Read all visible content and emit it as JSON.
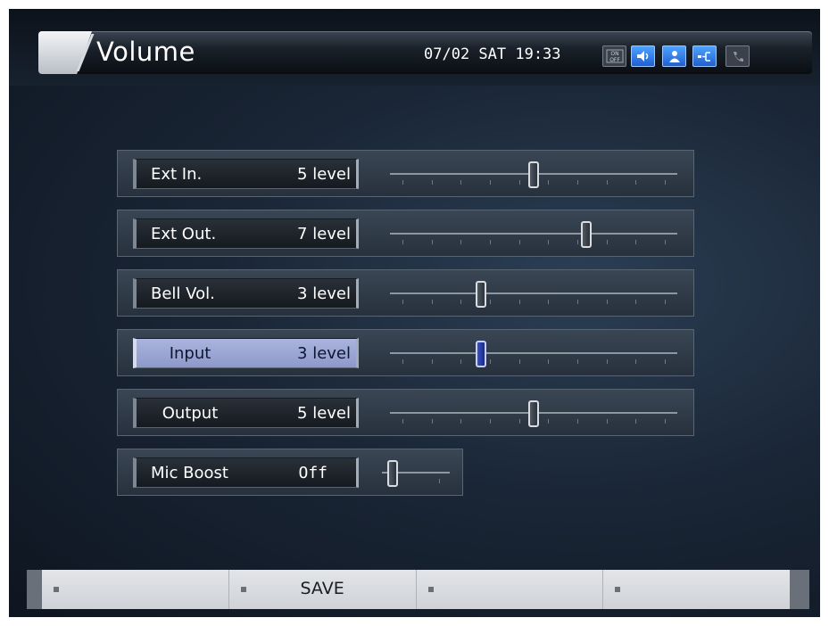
{
  "header": {
    "title": "Volume",
    "datetime": "07/02 SAT 19:33",
    "status_icons": [
      {
        "name": "on-off-icon",
        "text": "ON\nOFF"
      },
      {
        "name": "speaker-icon"
      },
      {
        "name": "person-icon"
      },
      {
        "name": "network-icon"
      },
      {
        "name": "phone-icon"
      }
    ]
  },
  "settings": [
    {
      "label": "Ext In.",
      "value": "5 level",
      "level": 5,
      "max": 10,
      "selected": false
    },
    {
      "label": "Ext Out.",
      "value": "7 level",
      "level": 7,
      "max": 10,
      "selected": false
    },
    {
      "label": "Bell Vol.",
      "value": "3 level",
      "level": 3,
      "max": 10,
      "selected": false
    },
    {
      "label": "Input",
      "value": "3 level",
      "level": 3,
      "max": 10,
      "selected": true
    },
    {
      "label": "Output",
      "value": "5 level",
      "level": 5,
      "max": 10,
      "selected": false
    },
    {
      "label": "Mic Boost",
      "value": "Off",
      "level": 0,
      "max": 1,
      "selected": false
    }
  ],
  "soft_keys": [
    "",
    "SAVE",
    "",
    ""
  ],
  "colors": {
    "selected_highlight": "#9aa5d6",
    "status_blue": "#2f7ee8"
  }
}
